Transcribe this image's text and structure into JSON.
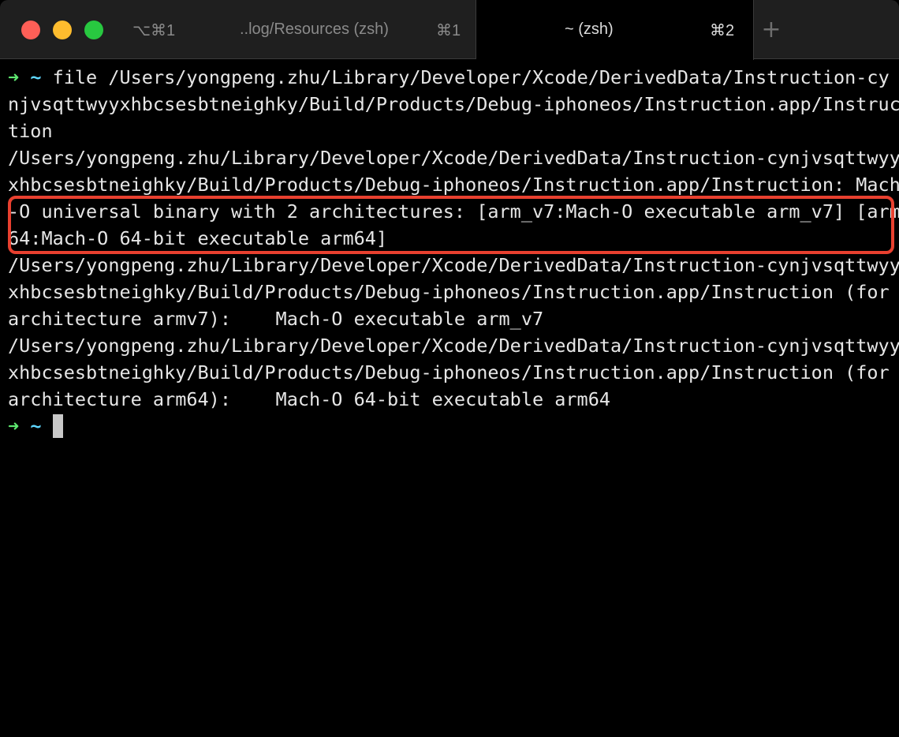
{
  "window": {
    "tabs": [
      {
        "window_key": "⌥⌘1",
        "title": "..log/Resources (zsh)",
        "shortcut": "⌘1",
        "active": false
      },
      {
        "title": "~ (zsh)",
        "shortcut": "⌘2",
        "active": true
      }
    ],
    "new_tab_symbol": "+"
  },
  "terminal": {
    "prompt_arrow": "➜",
    "prompt_dir": "~",
    "command": " file /Users/yongpeng.zhu/Library/Developer/Xcode/DerivedData/Instruction-cy",
    "lines": [
      "njvsqttwyyxhbcsesbtneighky/Build/Products/Debug-iphoneos/Instruction.app/Instruc",
      "tion",
      "/Users/yongpeng.zhu/Library/Developer/Xcode/DerivedData/Instruction-cynjvsqttwyy",
      "xhbcsesbtneighky/Build/Products/Debug-iphoneos/Instruction.app/Instruction: Mach",
      "-O universal binary with 2 architectures: [arm_v7:Mach-O executable arm_v7] [arm",
      "64:Mach-O 64-bit executable arm64]",
      "/Users/yongpeng.zhu/Library/Developer/Xcode/DerivedData/Instruction-cynjvsqttwyy",
      "xhbcsesbtneighky/Build/Products/Debug-iphoneos/Instruction.app/Instruction (for",
      "architecture armv7):    Mach-O executable arm_v7",
      "/Users/yongpeng.zhu/Library/Developer/Xcode/DerivedData/Instruction-cynjvsqttwyy",
      "xhbcsesbtneighky/Build/Products/Debug-iphoneos/Instruction.app/Instruction (for",
      "architecture arm64):    Mach-O 64-bit executable arm64"
    ]
  },
  "colors": {
    "background": "#000000",
    "tabbar": "#1f1f1f",
    "prompt_arrow": "#5ee870",
    "prompt_dir": "#5fd7ff",
    "highlight": "#e8402f",
    "text": "#e6e6e6"
  }
}
